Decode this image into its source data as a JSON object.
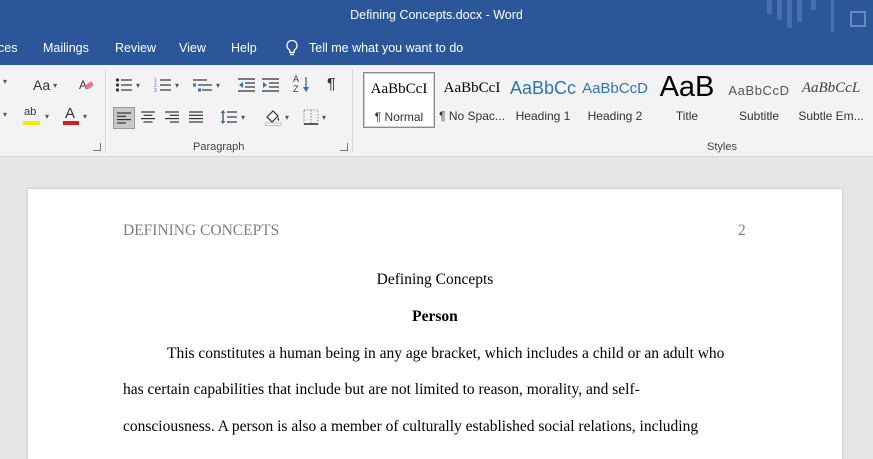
{
  "window": {
    "title": "Defining Concepts.docx  -  Word"
  },
  "tabs": [
    {
      "label": "ces"
    },
    {
      "label": "Mailings"
    },
    {
      "label": "Review"
    },
    {
      "label": "View"
    },
    {
      "label": "Help"
    }
  ],
  "tell_me": {
    "label": "Tell me what you want to do"
  },
  "ribbon": {
    "font_group": {
      "change_case_label": "Aa",
      "highlight_label": "ab",
      "font_color_label": "A",
      "highlight_color": "#ffe600",
      "font_color": "#d21f1f"
    },
    "paragraph_group": {
      "label": "Paragraph",
      "sort_label_top": "A",
      "sort_label_bottom": "Z",
      "pilcrow": "¶"
    },
    "styles_group": {
      "label": "Styles",
      "items": [
        {
          "sample": "AaBbCcI",
          "name": "¶ Normal"
        },
        {
          "sample": "AaBbCcI",
          "name": "¶ No Spac..."
        },
        {
          "sample": "AaBbCc",
          "name": "Heading 1"
        },
        {
          "sample": "AaBbCcD",
          "name": "Heading 2"
        },
        {
          "sample": "AaB",
          "name": "Title"
        },
        {
          "sample": "AaBbCcD",
          "name": "Subtitle"
        },
        {
          "sample": "AaBbCcL",
          "name": "Subtle Em..."
        }
      ]
    }
  },
  "document": {
    "running_head": "DEFINING CONCEPTS",
    "page_number": "2",
    "title": "Defining Concepts",
    "heading": "Person",
    "lines": [
      "This constitutes a human being in any age bracket, which includes a child or an adult who",
      "has certain capabilities that include but are not limited to reason, morality, and self-",
      "consciousness. A person is also a member of culturally established social relations, including"
    ]
  },
  "colors": {
    "title_bar": "#2b579a",
    "ribbon_bg": "#f3f3f3",
    "canvas_bg": "#e6e6e6",
    "heading_blue": "#2e74b5"
  }
}
